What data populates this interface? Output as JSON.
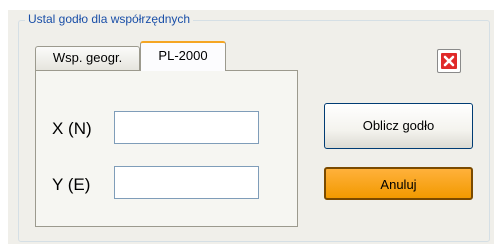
{
  "dialog": {
    "group_title": "Ustal godło dla współrzędnych",
    "tabs": [
      {
        "label": "Wsp. geogr."
      },
      {
        "label": "PL-2000"
      }
    ],
    "fields": {
      "x": {
        "label": "X (N)",
        "value": ""
      },
      "y": {
        "label": "Y (E)",
        "value": ""
      }
    },
    "buttons": {
      "calculate": "Oblicz godło",
      "cancel": "Anuluj"
    },
    "close_icon": "close-icon",
    "colors": {
      "accent": "#f5a623",
      "cancel_bg": "#ffa41a",
      "close_red": "#e02a2a",
      "legend_text": "#1a4fa8"
    }
  }
}
